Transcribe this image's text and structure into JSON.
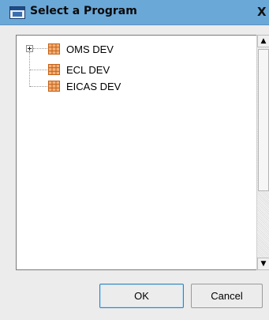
{
  "window": {
    "title": "Select a Program",
    "close_glyph": "X"
  },
  "tree": {
    "items": [
      {
        "label": "OMS DEV",
        "icon": "program-grid-icon",
        "expandable": true
      },
      {
        "label": "ECL DEV",
        "icon": "program-grid-icon",
        "expandable": false
      },
      {
        "label": "EICAS DEV",
        "icon": "program-grid-icon",
        "expandable": false
      }
    ]
  },
  "scrollbar": {
    "up_glyph": "▲",
    "down_glyph": "▼"
  },
  "buttons": {
    "ok_label": "OK",
    "cancel_label": "Cancel"
  },
  "colors": {
    "titlebar": "#6aa8d8",
    "icon_orange": "#d9761f"
  }
}
